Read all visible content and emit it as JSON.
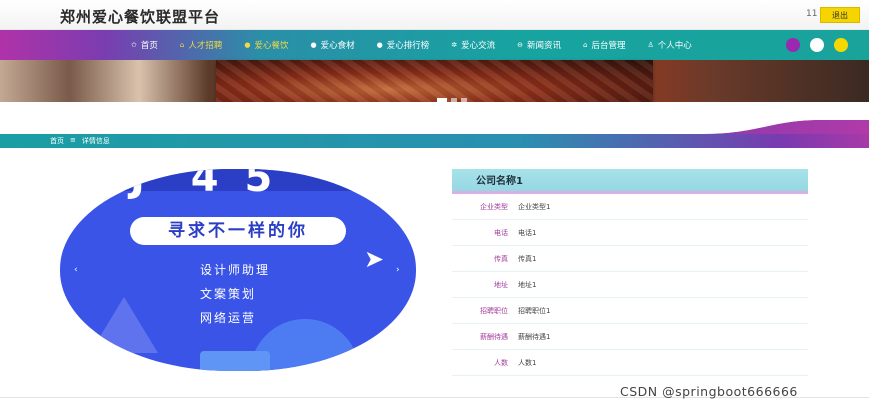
{
  "header": {
    "site_title": "郑州爱心餐饮联盟平台",
    "user_id": "11",
    "logout_label": "退出"
  },
  "nav": {
    "items": [
      {
        "label": "首页",
        "icon": "star-icon"
      },
      {
        "label": "人才招聘",
        "icon": "briefcase-icon"
      },
      {
        "label": "爱心餐饮",
        "icon": "dot-icon",
        "active": true
      },
      {
        "label": "爱心食材",
        "icon": "dot-icon"
      },
      {
        "label": "爱心排行榜",
        "icon": "dot-icon"
      },
      {
        "label": "爱心交流",
        "icon": "gear-icon"
      },
      {
        "label": "新闻资讯",
        "icon": "gear-icon"
      },
      {
        "label": "后台管理",
        "icon": "building-icon"
      },
      {
        "label": "个人中心",
        "icon": "user-icon"
      }
    ],
    "theme_colors": [
      "#9c27b0",
      "#ffffff",
      "#f5d800"
    ]
  },
  "breadcrumb": {
    "home": "首页",
    "separator": "≡",
    "current": "详情信息"
  },
  "carousel": {
    "headline": "寻求不一样的你",
    "jobs": [
      "设计师助理",
      "文案策划",
      "网络运营"
    ],
    "prev": "‹",
    "next": "›"
  },
  "detail": {
    "company_name": "公司名称1",
    "fields": [
      {
        "label": "企业类型",
        "value": "企业类型1"
      },
      {
        "label": "电话",
        "value": "电话1"
      },
      {
        "label": "传真",
        "value": "传真1"
      },
      {
        "label": "地址",
        "value": "地址1"
      },
      {
        "label": "招聘职位",
        "value": "招聘职位1"
      },
      {
        "label": "薪酬待遇",
        "value": "薪酬待遇1"
      },
      {
        "label": "人数",
        "value": "人数1"
      }
    ]
  },
  "watermark": "CSDN @springboot666666"
}
